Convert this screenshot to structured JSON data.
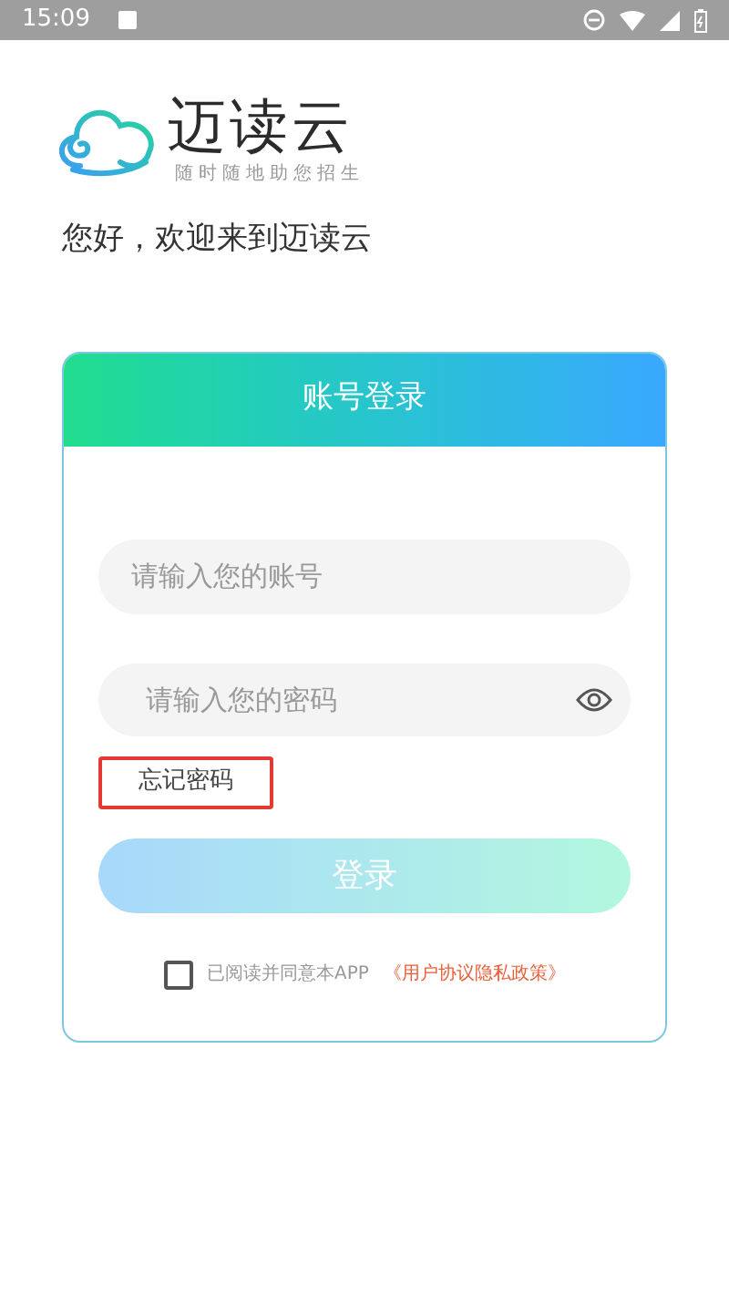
{
  "status_bar": {
    "time": "15:09"
  },
  "logo": {
    "name": "迈读云",
    "slogan": "随时随地助您招生"
  },
  "greeting": "您好，欢迎来到迈读云",
  "login_card": {
    "title": "账号登录",
    "account_field": {
      "placeholder": "请输入您的账号"
    },
    "password_field": {
      "placeholder": "请输入您的密码"
    },
    "forgot_password": {
      "label": "忘记密码",
      "highlighted": true
    },
    "login_button": {
      "label": "登录",
      "disabled": true
    },
    "agreement": {
      "checked": false,
      "text": "已阅读并同意本APP",
      "link": "《用户协议隐私政策》"
    }
  }
}
